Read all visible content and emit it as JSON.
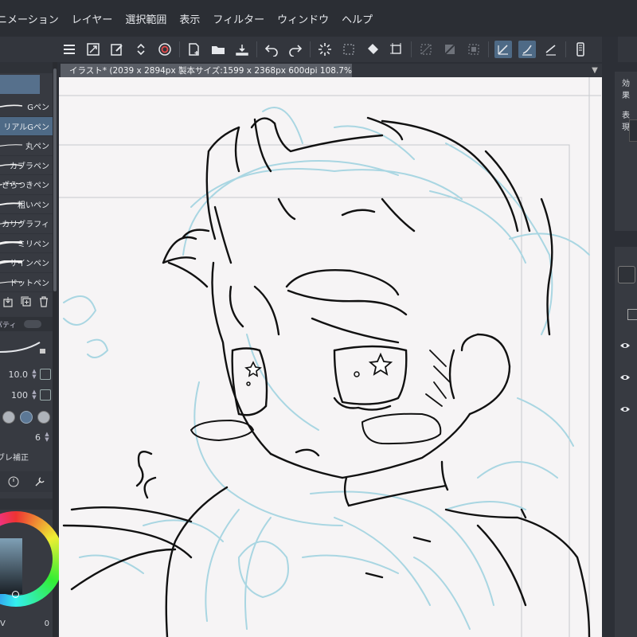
{
  "menu": {
    "items": [
      "ニメーション",
      "レイヤー",
      "選択範囲",
      "表示",
      "フィルター",
      "ウィンドウ",
      "ヘルプ"
    ]
  },
  "toolbar": {
    "icons": [
      "menu-icon",
      "resize-icon",
      "pen-edit-icon",
      "updown-icon",
      "swirl-icon",
      "new-page-icon",
      "open-folder-icon",
      "export-icon",
      "undo-icon",
      "redo-icon",
      "loading-icon",
      "lasso-icon",
      "fill-icon",
      "transform-icon",
      "deselect-icon",
      "invert-select-icon",
      "selection-border-icon",
      "ruler-pen-icon",
      "ruler-brush-icon",
      "ruler-line-icon",
      "phone-icon",
      "chevron-down-icon"
    ]
  },
  "document": {
    "tab_title": "イラスト* (2039 x 2894px 製本サイズ:1599 x 2368px 600dpi 108.7%)"
  },
  "brushes": {
    "items": [
      {
        "label": "Gペン",
        "selected": false
      },
      {
        "label": "リアルGペン",
        "selected": true
      },
      {
        "label": "丸ペン",
        "selected": false
      },
      {
        "label": "カブラペン",
        "selected": false
      },
      {
        "label": "ざらつきペン",
        "selected": false
      },
      {
        "label": "粗いペン",
        "selected": false
      },
      {
        "label": "カリグラフィ",
        "selected": false
      },
      {
        "label": "ミリペン",
        "selected": false
      },
      {
        "label": "サインペン",
        "selected": false
      },
      {
        "label": "ドットペン",
        "selected": false
      }
    ]
  },
  "property": {
    "header": "パティ",
    "brush_size": "10.0",
    "opacity": "100",
    "stabilization": "6",
    "stabilization_label": "ブレ補正"
  },
  "color": {
    "values": [
      "V",
      "0"
    ]
  },
  "right": {
    "effect_label": "効果",
    "expression_label": "表現"
  },
  "colors": {
    "sketch_blue": "#a9d6e2",
    "ink": "#111111",
    "accent_selected": "#4e6a86",
    "canvas_bg": "#f6f4f5"
  }
}
